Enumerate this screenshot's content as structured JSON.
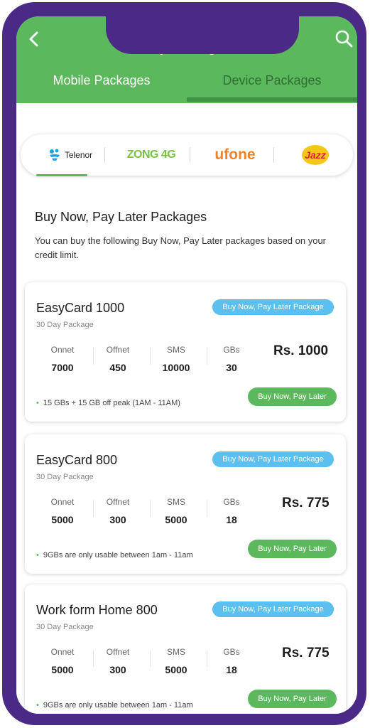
{
  "header": {
    "title": "Buy Packages",
    "tabs": [
      "Mobile Packages",
      "Device Packages"
    ]
  },
  "operators": [
    {
      "name": "Telenor"
    },
    {
      "name": "ZONG 4G"
    },
    {
      "name": "ufone"
    },
    {
      "name": "Jazz"
    }
  ],
  "section": {
    "title": "Buy Now, Pay Later Packages",
    "description": "You can buy the following Buy Now, Pay Later packages based on your credit limit."
  },
  "stat_labels": [
    "Onnet",
    "Offnet",
    "SMS",
    "GBs"
  ],
  "badge_label": "Buy Now, Pay Later Package",
  "buy_label": "Buy Now, Pay Later",
  "packages": [
    {
      "name": "EasyCard 1000",
      "validity": "30 Day Package",
      "onnet": "7000",
      "offnet": "450",
      "sms": "10000",
      "gbs": "30",
      "price": "Rs. 1000",
      "note": "15 GBs + 15 GB  off peak (1AM - 11AM)"
    },
    {
      "name": "EasyCard 800",
      "validity": "30 Day Package",
      "onnet": "5000",
      "offnet": "300",
      "sms": "5000",
      "gbs": "18",
      "price": "Rs. 775",
      "note": "9GBs are only usable between 1am - 11am"
    },
    {
      "name": "Work form Home 800",
      "validity": "30 Day Package",
      "onnet": "5000",
      "offnet": "300",
      "sms": "5000",
      "gbs": "18",
      "price": "Rs. 775",
      "note": "9GBs are only usable between 1am - 11am"
    }
  ],
  "colors": {
    "primary": "#5cb85c",
    "badge": "#5bc0f0",
    "frame": "#4a2a86"
  }
}
